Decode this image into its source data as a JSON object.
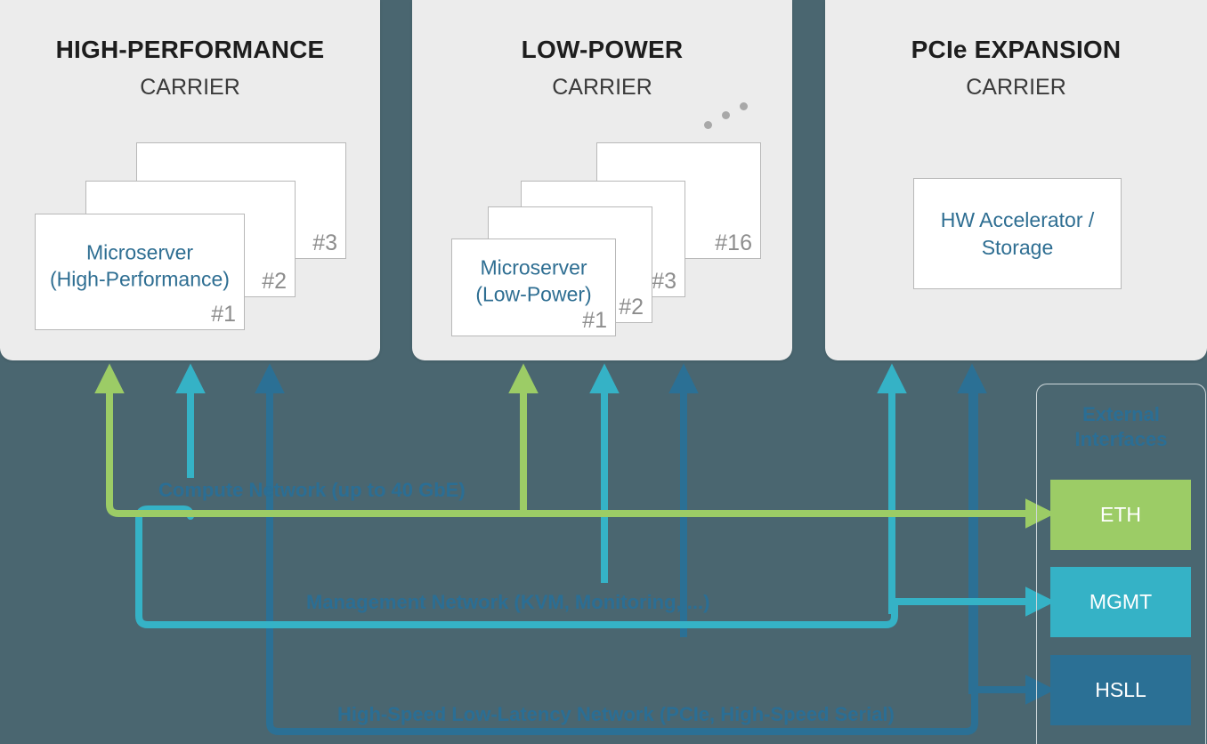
{
  "background_color": "#4a6670",
  "carriers": [
    {
      "title": "HIGH-PERFORMANCE",
      "subtitle": "CARRIER",
      "node_label_line1": "Microserver",
      "node_label_line2": "(High-Performance)",
      "card_numbers": [
        "#3",
        "#2",
        "#1"
      ],
      "has_ellipsis": false
    },
    {
      "title": "LOW-POWER",
      "subtitle": "CARRIER",
      "node_label_line1": "Microserver",
      "node_label_line2": "(Low-Power)",
      "card_numbers": [
        "#16",
        "#3",
        "#2",
        "#1"
      ],
      "has_ellipsis": true
    },
    {
      "title": "PCIe EXPANSION",
      "subtitle": "CARRIER",
      "box_label_line1": "HW Accelerator /",
      "box_label_line2": "Storage"
    }
  ],
  "networks": [
    {
      "id": "compute",
      "label": "Compute Network (up to 40 GbE)",
      "color": "#9ccc66",
      "target_interface": "ETH"
    },
    {
      "id": "management",
      "label": "Management Network (KVM, Monitoring, ...)",
      "color": "#35b2c6",
      "target_interface": "MGMT"
    },
    {
      "id": "hsll",
      "label": "High-Speed Low-Latency Network (PCIe, High-Speed Serial)",
      "color": "#2b7095",
      "target_interface": "HSLL"
    }
  ],
  "external_interfaces": {
    "title_line1": "External",
    "title_line2": "Interfaces",
    "items": [
      {
        "label": "ETH",
        "color": "#9ccc66"
      },
      {
        "label": "MGMT",
        "color": "#35b2c6"
      },
      {
        "label": "HSLL",
        "color": "#2b7095"
      }
    ]
  }
}
